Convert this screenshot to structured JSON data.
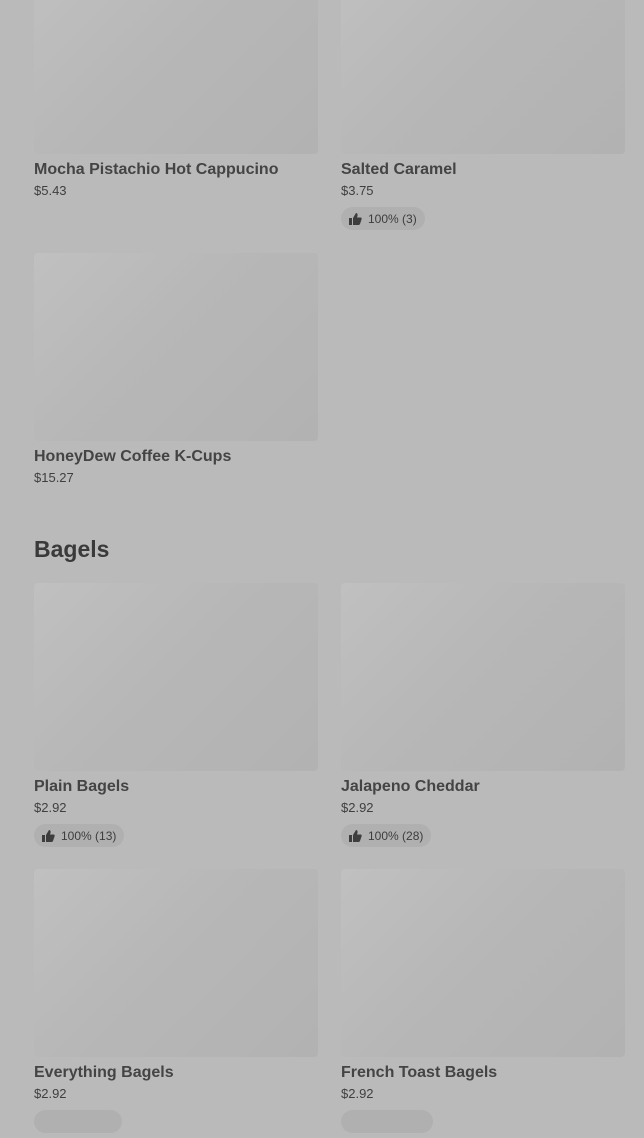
{
  "sections": [
    {
      "items": [
        {
          "name": "Mocha Pistachio Hot Cappucino",
          "price": "$5.43",
          "rating": ""
        },
        {
          "name": "Salted Caramel",
          "price": "$3.75",
          "rating": "100% (3)"
        },
        {
          "name": "HoneyDew Coffee K-Cups",
          "price": "$15.27",
          "rating": ""
        }
      ]
    },
    {
      "title": "Bagels",
      "items": [
        {
          "name": "Plain Bagels",
          "price": "$2.92",
          "rating": "100% (13)"
        },
        {
          "name": "Jalapeno Cheddar",
          "price": "$2.92",
          "rating": "100% (28)"
        },
        {
          "name": "Everything Bagels",
          "price": "$2.92",
          "rating": ""
        },
        {
          "name": "French Toast Bagels",
          "price": "$2.92",
          "rating": ""
        }
      ]
    }
  ]
}
